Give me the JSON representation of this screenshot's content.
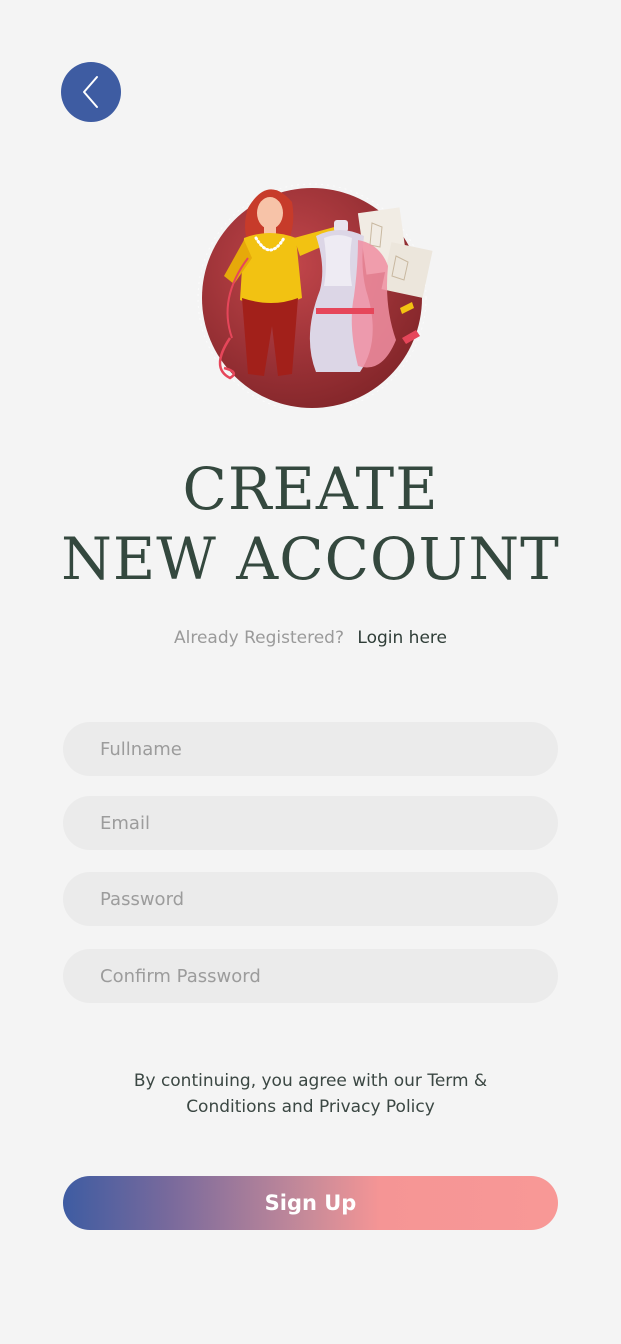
{
  "header": {
    "back_icon": "chevron-left-icon",
    "back_color": "#3e5ca2"
  },
  "illustration": {
    "icon": "tailor-with-mannequin-illustration"
  },
  "title": {
    "line1": "CREATE",
    "line2": "NEW ACCOUNT"
  },
  "login_prompt": {
    "text": "Already Registered?",
    "link": "Login here"
  },
  "form": {
    "fullname_placeholder": "Fullname",
    "email_placeholder": "Email",
    "password_placeholder": "Password",
    "confirm_placeholder": "Confirm Password"
  },
  "terms": {
    "line1": "By continuing, you agree with our Term &",
    "line2": "Conditions and Privacy Policy"
  },
  "signup": {
    "label": "Sign Up",
    "gradient_start": "#3e5ca2",
    "gradient_end": "#f89896"
  }
}
